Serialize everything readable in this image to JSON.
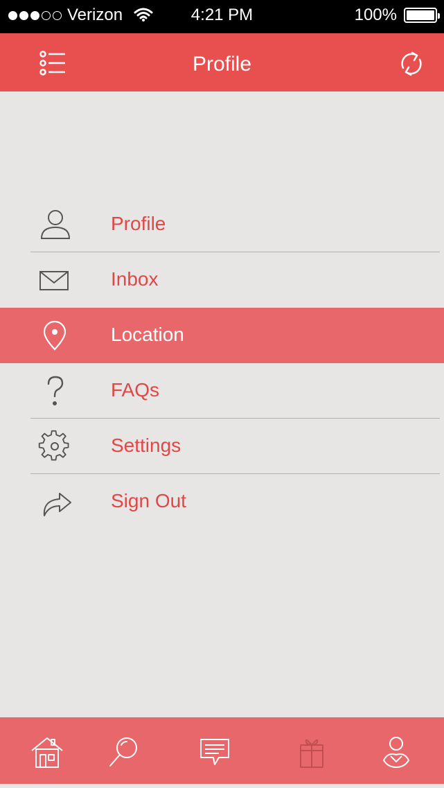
{
  "status_bar": {
    "carrier": "Verizon",
    "time": "4:21 PM",
    "battery": "100%"
  },
  "navbar": {
    "title": "Profile",
    "left_icon": "menu-list-icon",
    "right_icon": "refresh-icon"
  },
  "menu": {
    "items": [
      {
        "label": "Profile",
        "icon": "user-icon"
      },
      {
        "label": "Inbox",
        "icon": "envelope-icon"
      },
      {
        "label": "Location",
        "icon": "location-pin-icon",
        "active": true
      },
      {
        "label": "FAQs",
        "icon": "question-icon"
      },
      {
        "label": "Settings",
        "icon": "gear-icon"
      },
      {
        "label": "Sign Out",
        "icon": "share-arrow-icon"
      }
    ]
  },
  "tabbar": {
    "tabs": [
      {
        "icon": "home-icon"
      },
      {
        "icon": "search-icon"
      },
      {
        "icon": "chat-icon"
      },
      {
        "icon": "gift-icon"
      },
      {
        "icon": "account-icon"
      }
    ]
  },
  "colors": {
    "accent": "#e84f4f",
    "active_row": "#e8676a",
    "background": "#e7e6e4",
    "text_accent": "#e04848"
  }
}
